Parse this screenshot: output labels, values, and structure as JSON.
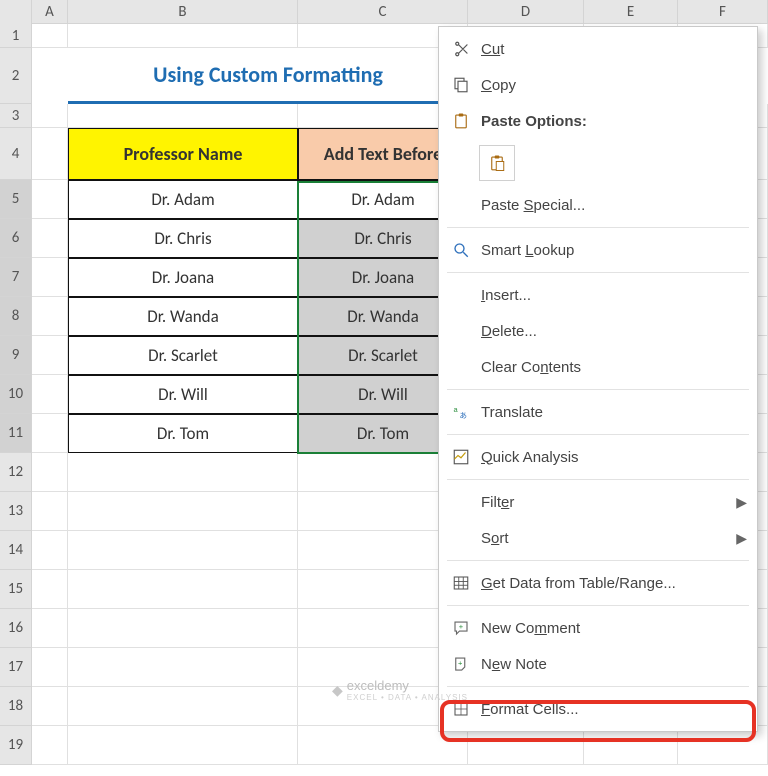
{
  "columns": [
    "A",
    "B",
    "C",
    "D",
    "E",
    "F"
  ],
  "row_nums": [
    "1",
    "2",
    "3",
    "4",
    "5",
    "6",
    "7",
    "8",
    "9",
    "10",
    "11",
    "12",
    "13",
    "14",
    "15",
    "16",
    "17",
    "18",
    "19"
  ],
  "title": "Using Custom Formatting",
  "headers": {
    "b": "Professor Name",
    "c": "Add Text Before"
  },
  "data": {
    "b": [
      "Dr. Adam",
      "Dr. Chris",
      "Dr. Joana",
      "Dr. Wanda",
      "Dr. Scarlet",
      "Dr. Will",
      "Dr. Tom"
    ],
    "c": [
      "Dr. Adam",
      "Dr. Chris",
      "Dr. Joana",
      "Dr. Wanda",
      "Dr. Scarlet",
      "Dr. Will",
      "Dr. Tom"
    ]
  },
  "menu": {
    "cut": "Cut",
    "copy": "Copy",
    "paste_options": "Paste Options:",
    "paste_special": "Paste Special...",
    "smart_lookup": "Smart Lookup",
    "insert": "Insert...",
    "delete": "Delete...",
    "clear_contents": "Clear Contents",
    "translate": "Translate",
    "quick_analysis": "Quick Analysis",
    "filter": "Filter",
    "sort": "Sort",
    "get_data": "Get Data from Table/Range...",
    "new_comment": "New Comment",
    "new_note": "New Note",
    "format_cells": "Format Cells..."
  },
  "watermark": {
    "brand": "exceldemy",
    "tagline": "EXCEL • DATA • ANALYSIS"
  }
}
